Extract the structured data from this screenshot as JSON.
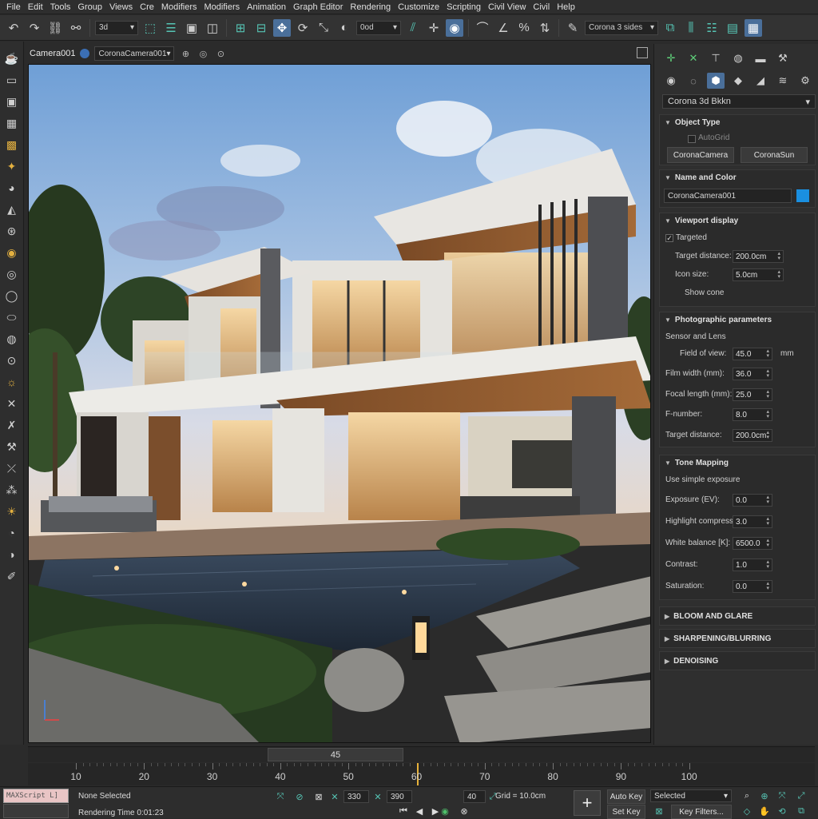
{
  "menu": [
    "File",
    "Edit",
    "Tools",
    "Group",
    "Views",
    "Cre",
    "Modifiers",
    "Modifiers",
    "Animation",
    "Graph Editor",
    "Rendering",
    "Customize",
    "Scripting",
    "Civil View",
    "Civil",
    "Help"
  ],
  "toolbar": {
    "selection_filter": "3d",
    "snap_dropdown": "0od",
    "named_selection": "Corona 3 sides"
  },
  "viewport": {
    "camera_label": "Camera001",
    "camera_dropdown": "CoronaCamera001"
  },
  "command_panel": {
    "category_dropdown": "Corona 3d Bkkn",
    "object_type": {
      "title": "Object Type",
      "autogrid_label": "AutoGrid",
      "buttons": [
        "CoronaCamera",
        "CoronaSun"
      ]
    },
    "name_and_color": {
      "title": "Name and Color",
      "name_value": "CoronaCamera001",
      "color": "#1a8fe0"
    },
    "viewport_display": {
      "title": "Viewport display",
      "targeted_label": "Targeted",
      "targeted_checked": true,
      "target_distance_label": "Target distance:",
      "target_distance_value": "200.0cm",
      "icon_size_label": "Icon size:",
      "icon_size_value": "5.0cm",
      "show_cone_label": "Show cone"
    },
    "photographic": {
      "title": "Photographic parameters",
      "sensor_label": "Sensor and Lens",
      "fov_label": "Field of view:",
      "fov_value": "45.0",
      "fov_unit": "mm",
      "film_width_label": "Film width (mm):",
      "film_width_value": "36.0",
      "focal_length_label": "Focal length (mm):",
      "focal_length_value": "25.0",
      "fnumber_label": "F-number:",
      "fnumber_value": "8.0",
      "target_distance_label": "Target distance:",
      "target_distance_value": "200.0cm"
    },
    "tone_mapping": {
      "title": "Tone Mapping",
      "simple_exposure_label": "Use simple exposure",
      "exposure_label": "Exposure (EV):",
      "exposure_value": "0.0",
      "highlight_label": "Highlight compress:",
      "highlight_value": "3.0",
      "white_balance_label": "White balance [K]:",
      "white_balance_value": "6500.0",
      "contrast_label": "Contrast:",
      "contrast_value": "1.0",
      "saturation_label": "Saturation:",
      "saturation_value": "0.0"
    },
    "collapsed_rollouts": [
      "BLOOM AND GLARE",
      "SHARPENING/BLURRING",
      "DENOISING"
    ]
  },
  "timeline": {
    "current_frame": "45",
    "ticks": [
      "10",
      "20",
      "30",
      "40",
      "50",
      "60",
      "70",
      "80",
      "90",
      "100"
    ],
    "tick_positions": [
      10,
      20,
      30,
      40,
      50,
      60,
      70,
      80,
      90,
      100
    ],
    "marker_frame": 60
  },
  "status": {
    "maxscript_label": "MAXScript L]",
    "selection_text": "None Selected",
    "rendering_time": "Rendering Time  0:01:23",
    "x_field": "330",
    "y_field": "390",
    "z_field": "40",
    "grid_text": "Grid = 10.0cm",
    "auto_key": "Auto Key",
    "set_key": "Set Key",
    "selected_dropdown": "Selected",
    "key_filters": "Key Filters..."
  }
}
